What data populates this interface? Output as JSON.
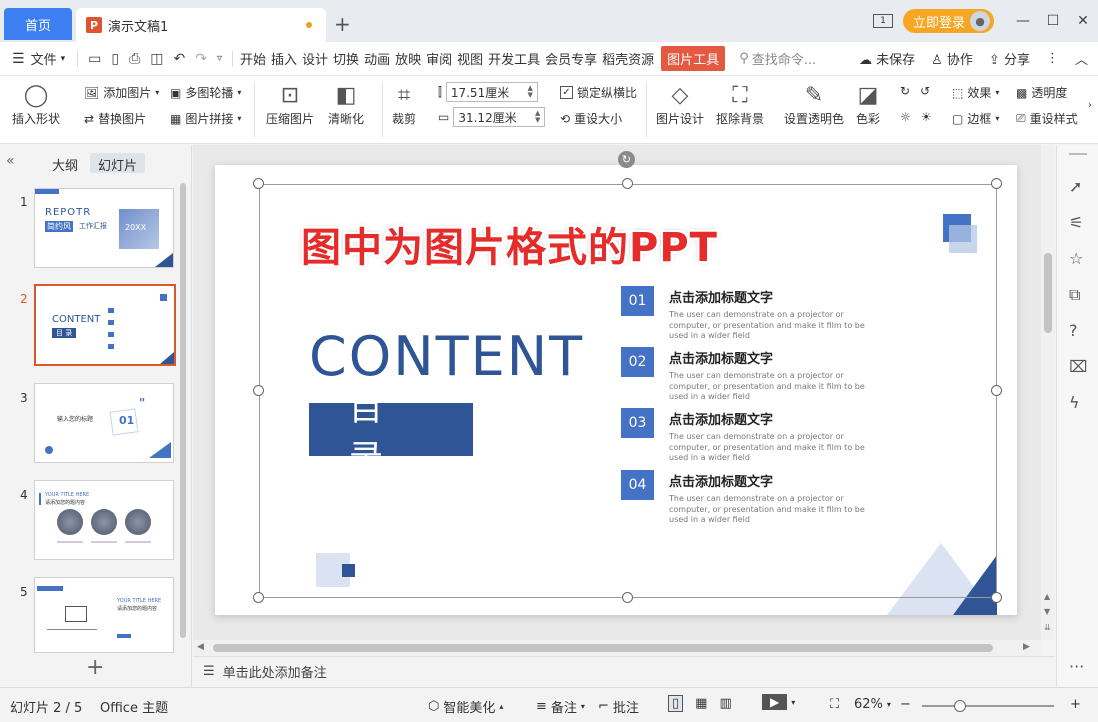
{
  "titlebar": {
    "home_tab": "首页",
    "doc_tab": "演示文稿1",
    "doc_icon": "P",
    "add_tab": "+",
    "page_indicator": "1",
    "login": "立即登录",
    "window_controls": [
      "—",
      "☐",
      "✕"
    ]
  },
  "menubar": {
    "file": "文件",
    "items": [
      "开始",
      "插入",
      "设计",
      "切换",
      "动画",
      "放映",
      "审阅",
      "视图",
      "开发工具",
      "会员专享",
      "稻壳资源"
    ],
    "picture_tool": "图片工具",
    "search_placeholder": "查找命令...",
    "unsaved": "未保存",
    "collab": "协作",
    "share": "分享"
  },
  "ribbon": {
    "insert_shape": "插入形状",
    "add_picture": "添加图片",
    "replace_picture": "替换图片",
    "multi_carousel": "多图轮播",
    "picture_splice": "图片拼接",
    "compress": "压缩图片",
    "clarify": "清晰化",
    "crop": "裁剪",
    "height_value": "17.51厘米",
    "width_value": "31.12厘米",
    "lock_ratio": "锁定纵横比",
    "reset_size": "重设大小",
    "picture_design": "图片设计",
    "remove_bg": "抠除背景",
    "set_transparent": "设置透明色",
    "color": "色彩",
    "effect": "效果",
    "transparency": "透明度",
    "border": "边框",
    "reset_style": "重设样式"
  },
  "leftpanel": {
    "outline_tab": "大纲",
    "slides_tab": "幻灯片",
    "thumbs": [
      {
        "num": "1",
        "t1": "REPOTR",
        "t2": "简约风",
        "t3": "工作汇报",
        "t4": "20XX"
      },
      {
        "num": "2",
        "t1": "CONTENT",
        "t2": "目 录"
      },
      {
        "num": "3",
        "t1": "输入您的标题",
        "t2": "01"
      },
      {
        "num": "4",
        "t1": "YOUR TITLE HERE",
        "t2": "请添加您的题内容"
      },
      {
        "num": "5",
        "t1": "YOUR TITLE HERE",
        "t2": "请添加您的题内容"
      }
    ]
  },
  "slide": {
    "overlay_title": "图中为图片格式的PPT",
    "content_word": "CONTENT",
    "mulu": "目录",
    "items": [
      {
        "num": "01",
        "title": "点击添加标题文字",
        "desc": "The user can demonstrate on a projector or computer, or presentation and make it film to be used in a wider field"
      },
      {
        "num": "02",
        "title": "点击添加标题文字",
        "desc": "The user can demonstrate on a projector or computer, or presentation and make it film to be used in a wider field"
      },
      {
        "num": "03",
        "title": "点击添加标题文字",
        "desc": "The user can demonstrate on a projector or computer, or presentation and make it film to be used in a wider field"
      },
      {
        "num": "04",
        "title": "点击添加标题文字",
        "desc": "The user can demonstrate on a projector or computer, or presentation and make it film to be used in a wider field"
      }
    ]
  },
  "notes": {
    "placeholder": "单击此处添加备注"
  },
  "statusbar": {
    "slide_count": "幻灯片 2 / 5",
    "theme": "Office 主题",
    "smart_beautify": "智能美化",
    "notes": "备注",
    "comments": "批注",
    "zoom": "62%"
  },
  "colors": {
    "accent_blue": "#2f5597",
    "item_blue": "#4472c4",
    "home_tab": "#3d7ff0",
    "picture_tool": "#e35a40",
    "overlay_red": "#e62b2b",
    "login": "#f6a623"
  }
}
